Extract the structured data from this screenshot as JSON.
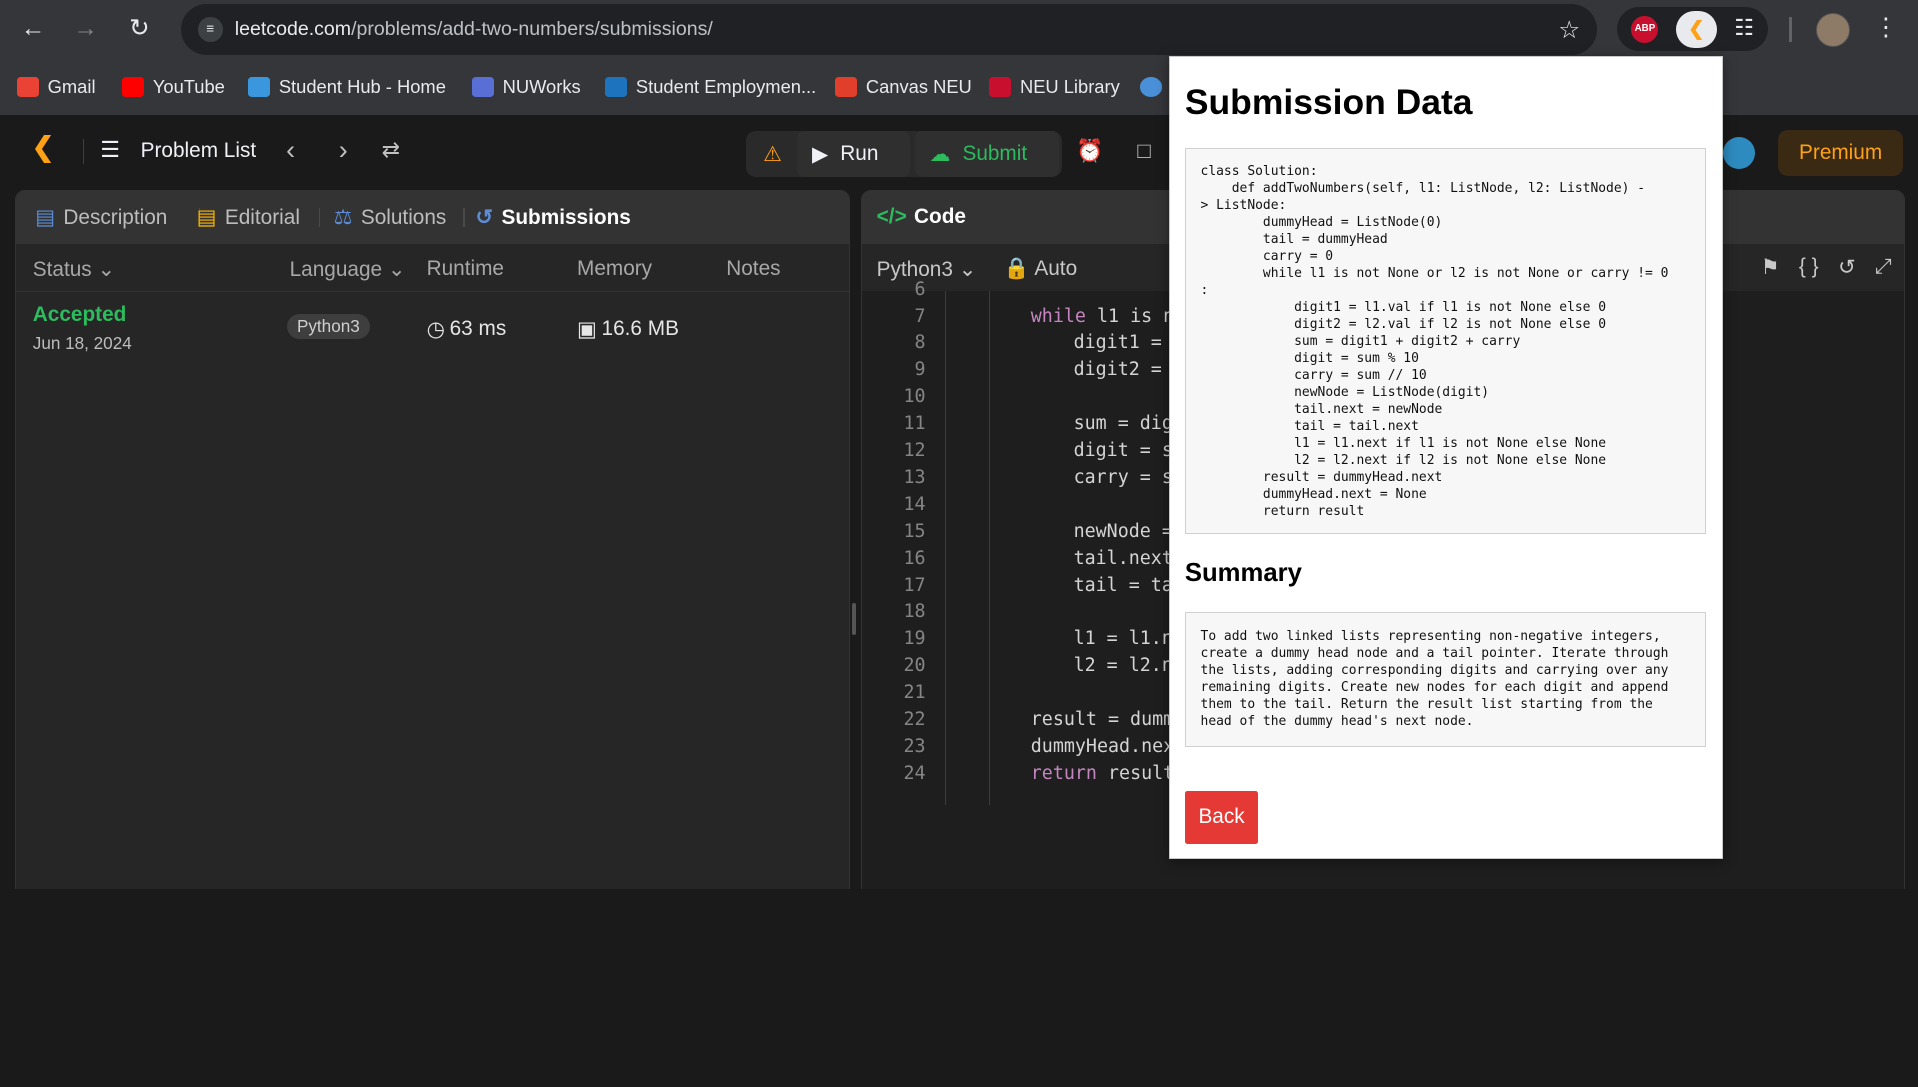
{
  "browser": {
    "url_host": "leetcode.com",
    "url_path": "/problems/add-two-numbers/submissions/",
    "bookmarks": [
      {
        "label": "Gmail",
        "color": "#ea4335"
      },
      {
        "label": "YouTube",
        "color": "#ff0000"
      },
      {
        "label": "Student Hub - Home",
        "color": "#3a96dd"
      },
      {
        "label": "NUWorks",
        "color": "#5a6fd6"
      },
      {
        "label": "Student Employmen...",
        "color": "#1e73be"
      },
      {
        "label": "Canvas NEU",
        "color": "#e13f2b"
      },
      {
        "label": "NEU Library",
        "color": "#c8102e"
      }
    ],
    "ext_abp": "ABP"
  },
  "nav": {
    "problem_list": "Problem List",
    "run": "Run",
    "submit": "Submit",
    "premium": "Premium"
  },
  "left": {
    "tabs": [
      {
        "label": "Description",
        "icon": "document-icon"
      },
      {
        "label": "Editorial",
        "icon": "book-icon"
      },
      {
        "label": "Solutions",
        "icon": "flask-icon"
      },
      {
        "label": "Submissions",
        "icon": "history-icon"
      }
    ],
    "columns": {
      "status": "Status",
      "language": "Language",
      "runtime": "Runtime",
      "memory": "Memory",
      "notes": "Notes"
    },
    "submission": {
      "status": "Accepted",
      "date": "Jun 18, 2024",
      "language": "Python3",
      "runtime": "63 ms",
      "memory": "16.6 MB"
    }
  },
  "code": {
    "title": "Code",
    "language": "Python3",
    "mode": "Auto",
    "lines": [
      {
        "n": "6",
        "text": ""
      },
      {
        "n": "7",
        "text": "while l1 is n",
        "kw": true
      },
      {
        "n": "8",
        "text": "digit1 = "
      },
      {
        "n": "9",
        "text": "digit2 = "
      },
      {
        "n": "10",
        "text": ""
      },
      {
        "n": "11",
        "text": "sum = dig"
      },
      {
        "n": "12",
        "text": "digit = s"
      },
      {
        "n": "13",
        "text": "carry = s"
      },
      {
        "n": "14",
        "text": ""
      },
      {
        "n": "15",
        "text": "newNode = "
      },
      {
        "n": "16",
        "text": "tail.next"
      },
      {
        "n": "17",
        "text": "tail = ta"
      },
      {
        "n": "18",
        "text": ""
      },
      {
        "n": "19",
        "text": "l1 = l1.n"
      },
      {
        "n": "20",
        "text": "l2 = l2.n"
      },
      {
        "n": "21",
        "text": ""
      },
      {
        "n": "22",
        "text": "result = dumm"
      },
      {
        "n": "23",
        "text": "dummyHead.nex"
      },
      {
        "n": "24",
        "text": "return result"
      }
    ]
  },
  "popup": {
    "title": "Submission Data",
    "code": "class Solution:\n    def addTwoNumbers(self, l1: ListNode, l2: ListNode) -\n> ListNode:\n        dummyHead = ListNode(0)\n        tail = dummyHead\n        carry = 0\n        while l1 is not None or l2 is not None or carry != 0\n:\n            digit1 = l1.val if l1 is not None else 0\n            digit2 = l2.val if l2 is not None else 0\n            sum = digit1 + digit2 + carry\n            digit = sum % 10\n            carry = sum // 10\n            newNode = ListNode(digit)\n            tail.next = newNode\n            tail = tail.next\n            l1 = l1.next if l1 is not None else None\n            l2 = l2.next if l2 is not None else None\n        result = dummyHead.next\n        dummyHead.next = None\n        return result",
    "summary_title": "Summary",
    "summary": "To add two linked lists representing non-negative integers, create a dummy head node and a tail pointer. Iterate through the lists, adding corresponding digits and carrying over any remaining digits. Create new nodes for each digit and append them to the tail. Return the result list starting from the head of the dummy head's next node.",
    "back": "Back"
  }
}
